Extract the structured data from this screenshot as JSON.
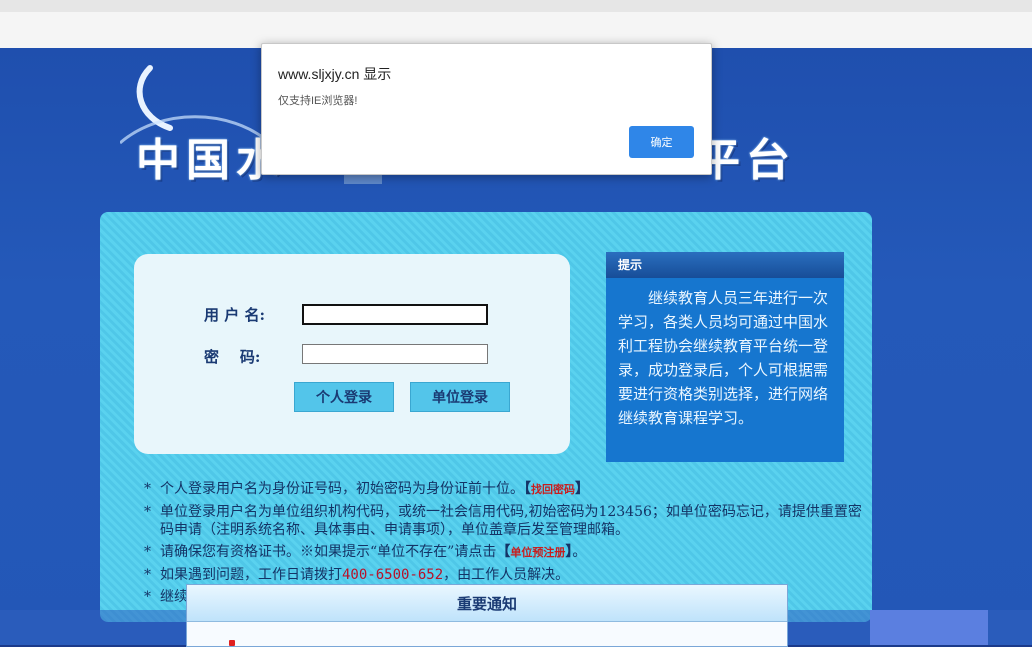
{
  "banner": {
    "title_left": "中国水",
    "title_right": "平台"
  },
  "login": {
    "username_label": "用 户 名:",
    "password_label": "密    码:",
    "username_value": "",
    "password_value": "",
    "personal_login": "个人登录",
    "unit_login": "单位登录"
  },
  "tip": {
    "heading": "提示",
    "body": "继续教育人员三年进行一次学习，各类人员均可通过中国水利工程协会继续教育平台统一登录，成功登录后，个人可根据需要进行资格类别选择，进行网络继续教育课程学习。"
  },
  "notes": {
    "n1_text": "个人登录用户名为身份证号码，初始密码为身份证前十位。",
    "n1_link": "找回密码",
    "n2_text": "单位登录用户名为单位组织机构代码，或统一社会信用代码,初始密码为123456；如单位密码忘记，请提供重置密码申请（注明系统名称、具体事由、申请事项），单位盖章后发至管理邮箱。",
    "n3_text": "请确保您有资格证书。※如果提示“单位不存在”请点击",
    "n3_link": "单位预注册",
    "n3_end": "。",
    "n4_text_a": "如果遇到问题，工作日请拨打",
    "n4_phone": "400-6500-652",
    "n4_text_b": "，由工作人员解决。",
    "n5_text": "继续"
  },
  "notice": {
    "heading": "重要通知"
  },
  "dialog": {
    "title": "www.sljxjy.cn 显示",
    "message": "仅支持IE浏览器!",
    "ok_label": "确定"
  },
  "colors": {
    "accent": "#2f86e8",
    "page_bg": "#2357b7",
    "panel": "#5ad2ef",
    "tip_bg": "#1676cf",
    "link_red": "#c81e1e"
  }
}
